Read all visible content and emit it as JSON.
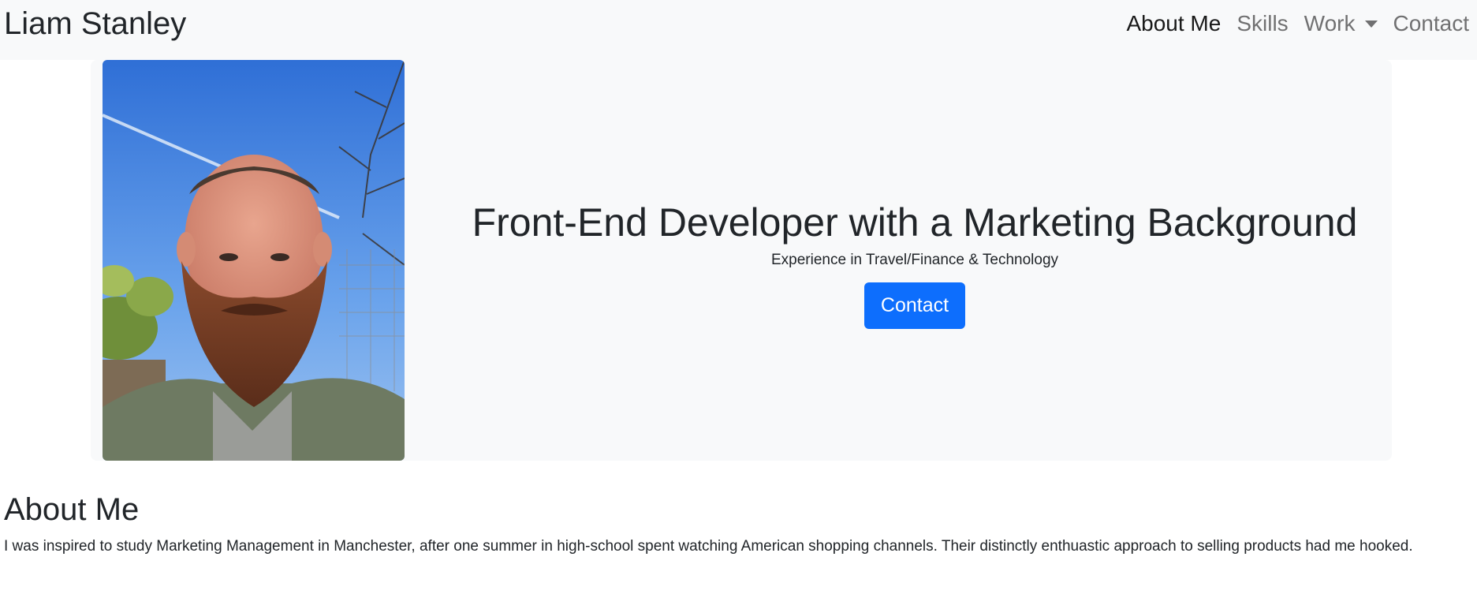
{
  "navbar": {
    "brand": "Liam Stanley",
    "links": [
      {
        "label": "About Me",
        "active": true
      },
      {
        "label": "Skills",
        "active": false
      },
      {
        "label": "Work",
        "active": false,
        "dropdown": true
      },
      {
        "label": "Contact",
        "active": false
      }
    ]
  },
  "hero": {
    "portrait_alt": "Portrait photo",
    "title": "Front-End Developer with a Marketing Background",
    "subtitle": "Experience in Travel/Finance & Technology",
    "button_label": "Contact",
    "button_color": "#0d6efd"
  },
  "about": {
    "title": "About Me",
    "text": "I was inspired to study Marketing Management in Manchester, after one summer in high-school spent watching American shopping channels. Their distinctly enthuastic approach to selling products had me hooked."
  },
  "colors": {
    "navbar_bg": "#f8f9fa",
    "hero_bg": "#f8f9fa",
    "text": "#212529",
    "primary": "#0d6efd"
  }
}
